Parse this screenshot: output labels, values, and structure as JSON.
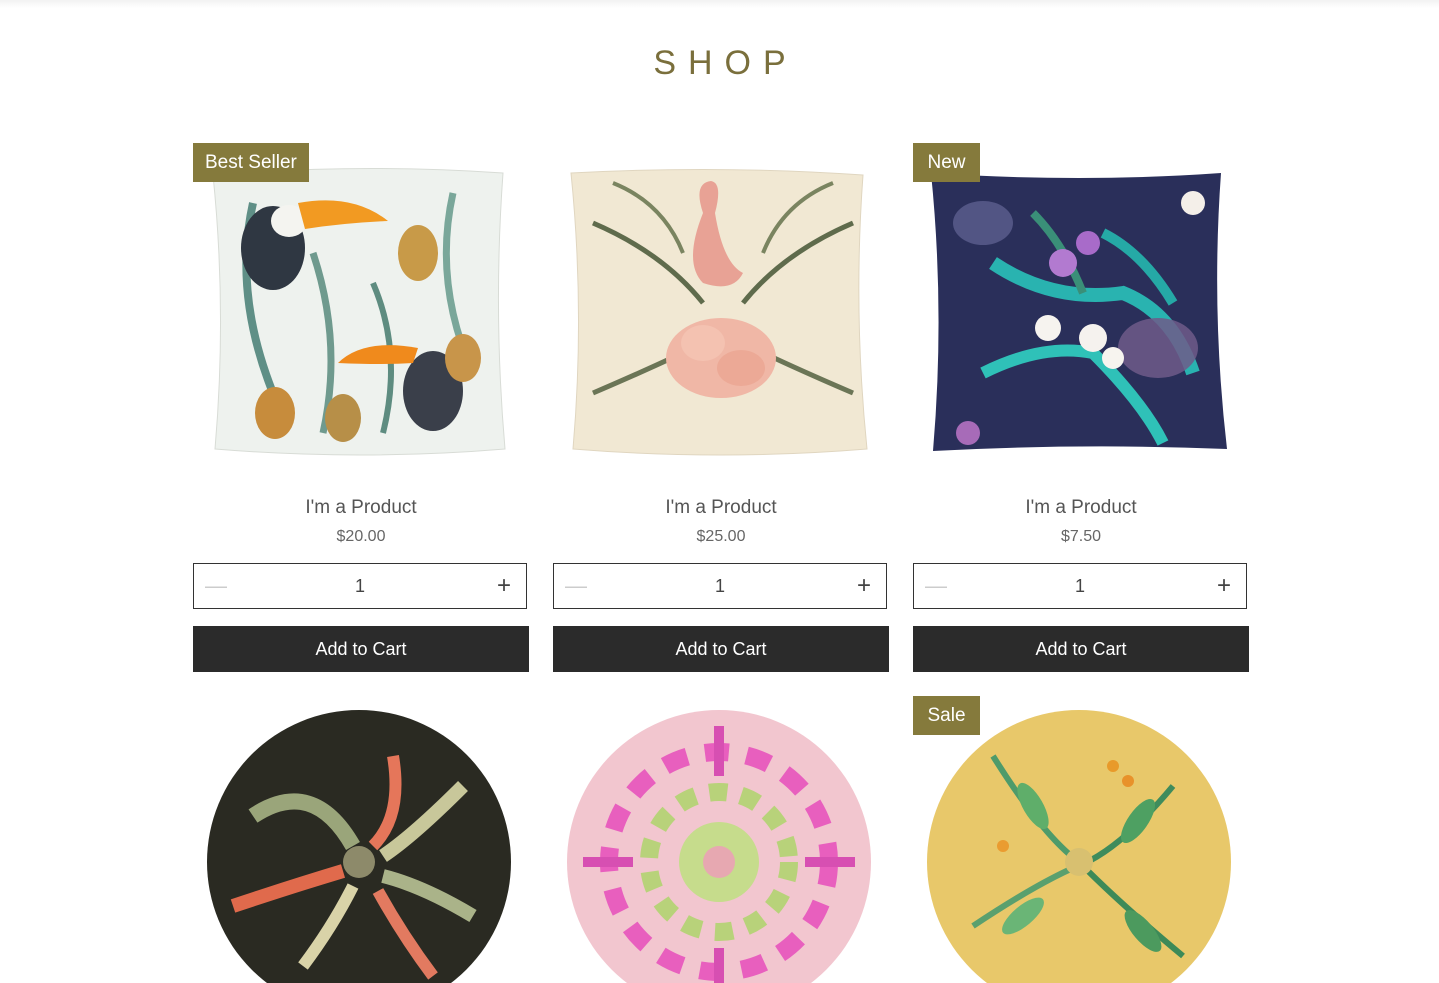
{
  "page": {
    "title": "SHOP"
  },
  "colors": {
    "accent": "#857a3c",
    "button": "#2b2b2b",
    "title": "#7a6f3c"
  },
  "products": [
    {
      "badge": "Best Seller",
      "name": "I'm a Product",
      "price": "$20.00",
      "qty": "1",
      "cta": "Add to Cart",
      "image": "toucan-pineapple-cushion"
    },
    {
      "badge": "",
      "name": "I'm a Product",
      "price": "$25.00",
      "qty": "1",
      "cta": "Add to Cart",
      "image": "flamingo-palm-cushion"
    },
    {
      "badge": "New",
      "name": "I'm a Product",
      "price": "$7.50",
      "qty": "1",
      "cta": "Add to Cart",
      "image": "orchid-monstera-cushion"
    },
    {
      "badge": "",
      "image": "bird-of-paradise-round-cushion"
    },
    {
      "badge": "",
      "image": "pink-ikat-round-cushion"
    },
    {
      "badge": "Sale",
      "image": "yellow-botanical-round-cushion"
    }
  ]
}
